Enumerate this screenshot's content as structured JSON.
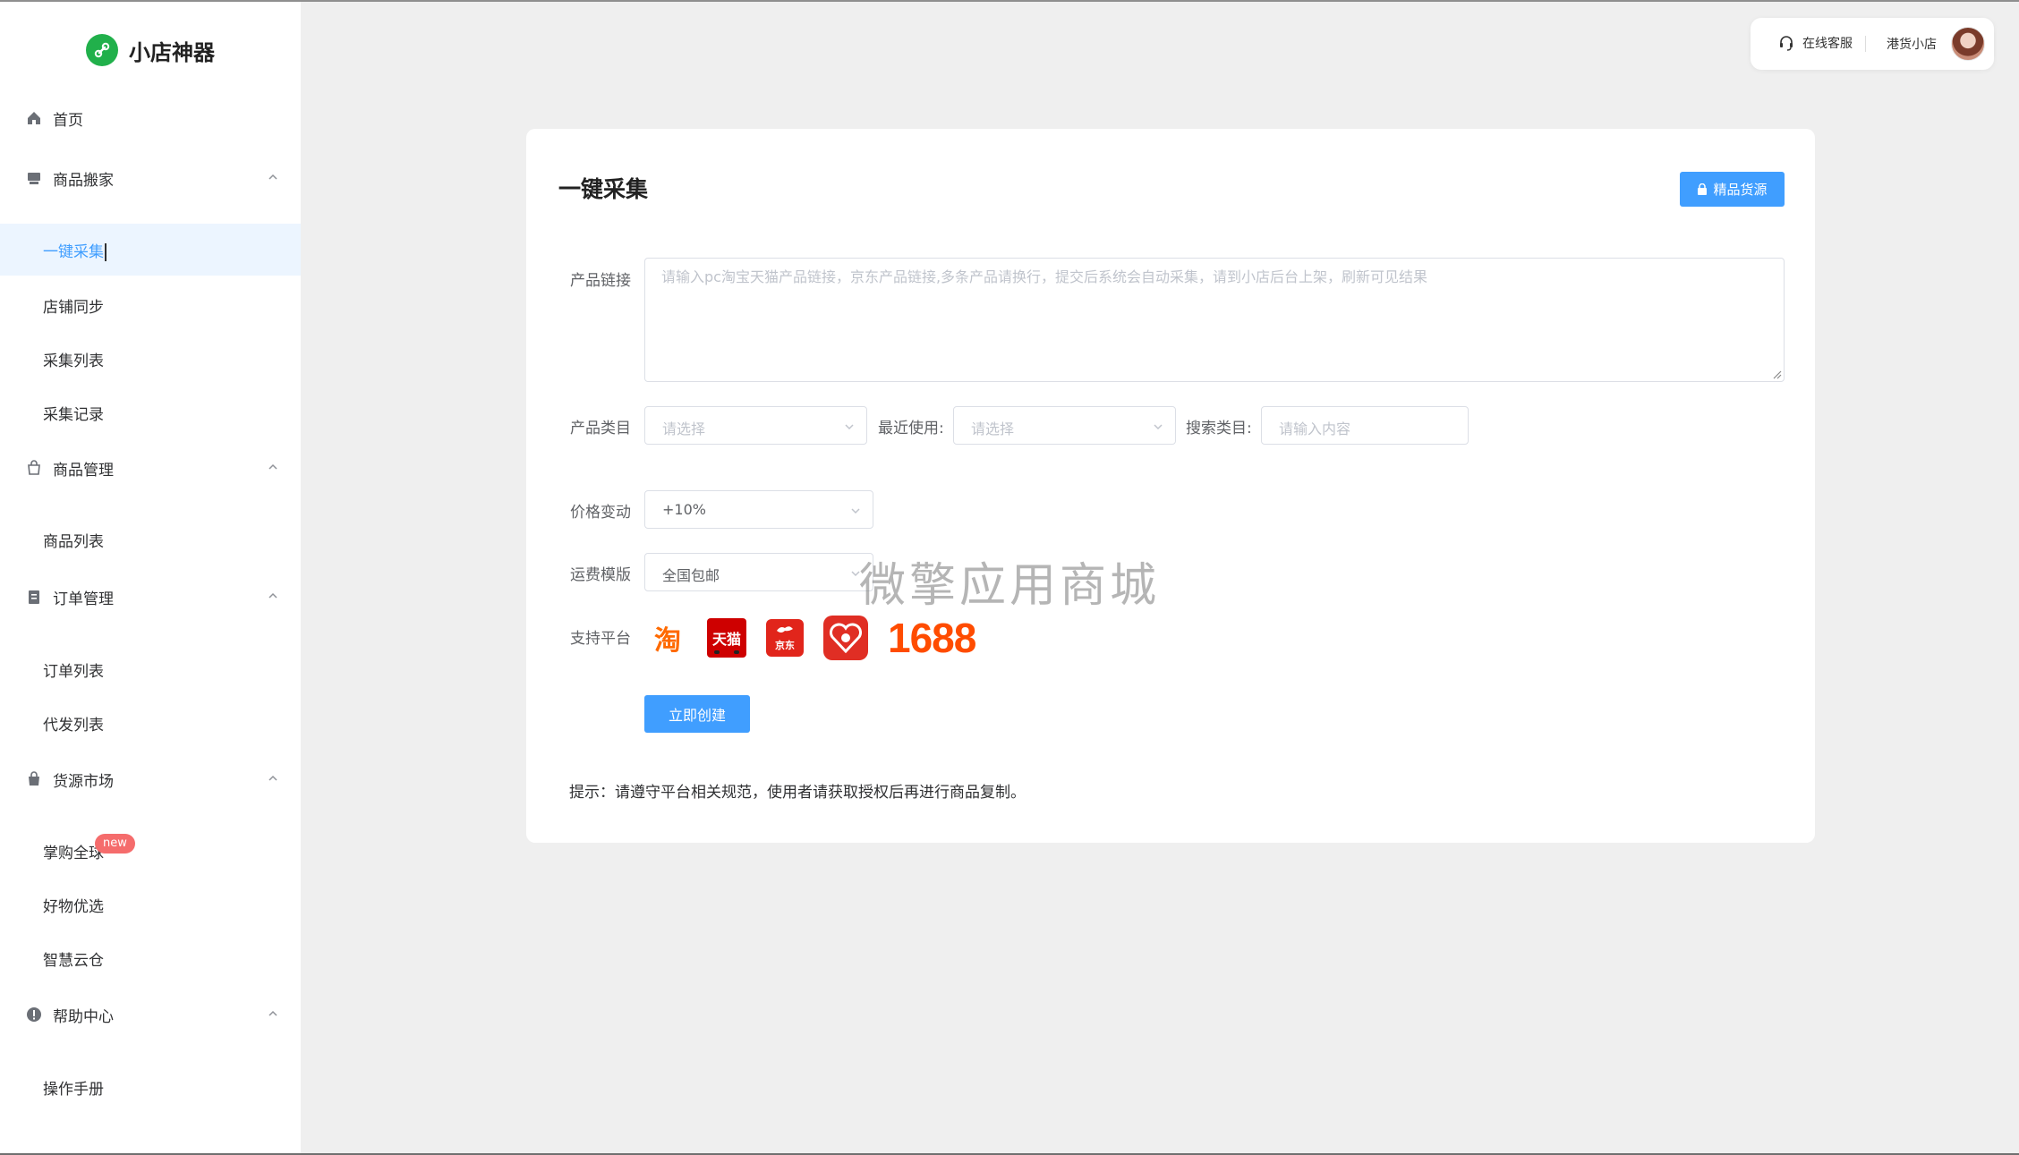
{
  "app": {
    "name": "小店神器"
  },
  "sidebar": {
    "home": "首页",
    "groups": [
      {
        "label": "商品搬家",
        "items": [
          "一键采集",
          "店铺同步",
          "采集列表",
          "采集记录"
        ]
      },
      {
        "label": "商品管理",
        "items": [
          "商品列表"
        ]
      },
      {
        "label": "订单管理",
        "items": [
          "订单列表",
          "代发列表"
        ]
      },
      {
        "label": "货源市场",
        "items": [
          "掌购全球",
          "好物优选",
          "智慧云仓"
        ]
      },
      {
        "label": "帮助中心",
        "items": [
          "操作手册"
        ]
      }
    ],
    "new_badge": "new"
  },
  "header": {
    "support": "在线客服",
    "shop": "港货小店"
  },
  "main": {
    "title": "一键采集",
    "premium_button": "精品货源",
    "product_link_label": "产品链接",
    "product_link_placeholder": "请输入pc淘宝天猫产品链接，京东产品链接,多条产品请换行，提交后系统会自动采集，请到小店后台上架，刷新可见结果",
    "category_label": "产品类目",
    "category_placeholder": "请选择",
    "recent_label": "最近使用:",
    "recent_placeholder": "请选择",
    "search_label": "搜索类目:",
    "search_placeholder": "请输入内容",
    "price_label": "价格变动",
    "price_value": "+10%",
    "freight_label": "运费模版",
    "freight_value": "全国包邮",
    "platform_label": "支持平台",
    "platforms": [
      "淘",
      "天猫",
      "京东",
      "拼多多",
      "1688"
    ],
    "create_button": "立即创建",
    "tip": "提示：请遵守平台相关规范，使用者请获取授权后再进行商品复制。"
  },
  "watermark": "微擎应用商城",
  "colors": {
    "primary": "#409eff",
    "badge": "#f56c6c",
    "logo": "#21b04b",
    "active_bg": "#ecf5ff"
  }
}
